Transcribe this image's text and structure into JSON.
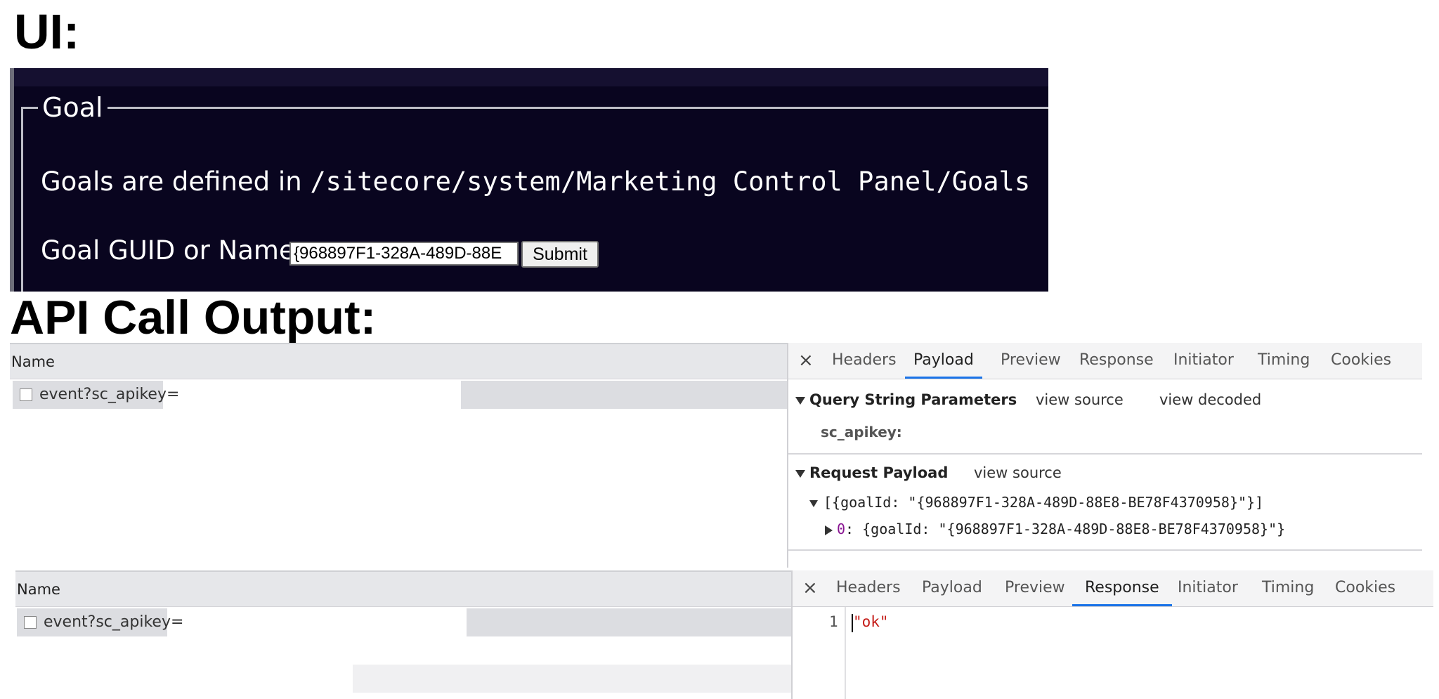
{
  "headings": {
    "ui": "UI:",
    "api": "API Call Output:"
  },
  "ui_panel": {
    "legend": "Goal",
    "description_text": "Goals are defined in ",
    "description_path": "/sitecore/system/Marketing Control Panel/Goals",
    "field_label": "Goal GUID or Name",
    "input_value": "{968897F1-328A-489D-88E",
    "submit_label": "Submit"
  },
  "devtools_payload": {
    "name_header": "Name",
    "request_name": "event?sc_apikey=",
    "tabs": [
      "Headers",
      "Payload",
      "Preview",
      "Response",
      "Initiator",
      "Timing",
      "Cookies"
    ],
    "active_tab": "Payload",
    "close_icon": "×",
    "query_section": "Query String Parameters",
    "view_source": "view source",
    "view_decoded": "view decoded",
    "param_key": "sc_apikey:",
    "payload_section": "Request Payload",
    "payload_view_source": "view source",
    "payload_array": "[{goalId: \"{968897F1-328A-489D-88E8-BE78F4370958}\"}]",
    "payload_item_index": "0",
    "payload_item": ": {goalId: \"{968897F1-328A-489D-88E8-BE78F4370958}\"}"
  },
  "devtools_response": {
    "name_header": "Name",
    "request_name": "event?sc_apikey=",
    "tabs": [
      "Headers",
      "Payload",
      "Preview",
      "Response",
      "Initiator",
      "Timing",
      "Cookies"
    ],
    "active_tab": "Response",
    "close_icon": "×",
    "line_number": "1",
    "response_body": "\"ok\""
  }
}
